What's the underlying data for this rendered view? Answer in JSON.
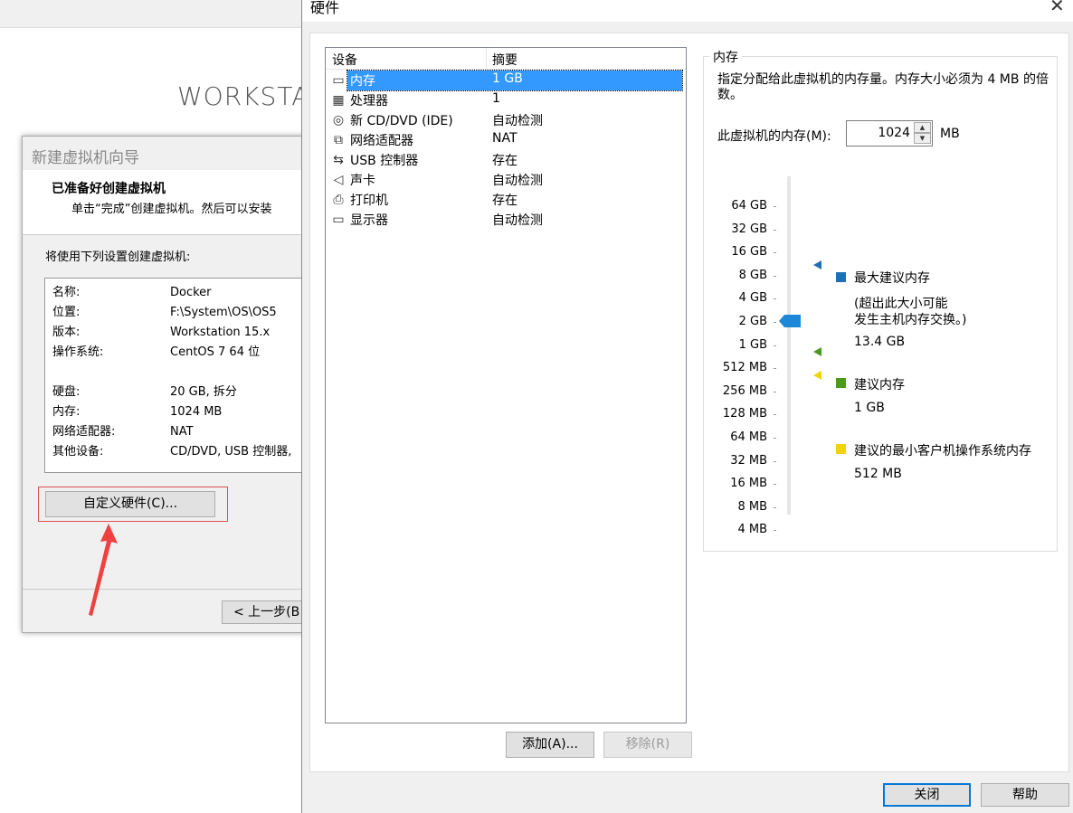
{
  "background": {
    "logo_text": "WORKSTA"
  },
  "wizard": {
    "title": "新建虚拟机向导",
    "heading": "已准备好创建虚拟机",
    "subheading": "单击“完成”创建虚拟机。然后可以安装",
    "intro": "将使用下列设置创建虚拟机:",
    "summary": [
      {
        "key": "名称:",
        "value": "Docker"
      },
      {
        "key": "位置:",
        "value": "F:\\System\\OS\\OS5"
      },
      {
        "key": "版本:",
        "value": "Workstation 15.x"
      },
      {
        "key": "操作系统:",
        "value": "CentOS 7 64 位"
      },
      {
        "key": "硬盘:",
        "value": "20 GB, 拆分"
      },
      {
        "key": "内存:",
        "value": "1024 MB"
      },
      {
        "key": "网络适配器:",
        "value": "NAT"
      },
      {
        "key": "其他设备:",
        "value": "CD/DVD, USB 控制器,"
      }
    ],
    "customize_button": "自定义硬件(C)...",
    "back_button": "< 上一步(B"
  },
  "hardware_dialog": {
    "title": "硬件",
    "close_glyph": "✕",
    "columns": {
      "device": "设备",
      "summary": "摘要"
    },
    "devices": [
      {
        "icon": "memory-icon",
        "glyph": "▭",
        "name": "内存",
        "summary": "1 GB",
        "selected": true
      },
      {
        "icon": "processor-icon",
        "glyph": "▦",
        "name": "处理器",
        "summary": "1",
        "selected": false
      },
      {
        "icon": "cd-dvd-icon",
        "glyph": "◎",
        "name": "新 CD/DVD (IDE)",
        "summary": "自动检测",
        "selected": false
      },
      {
        "icon": "network-adapter-icon",
        "glyph": "⧉",
        "name": "网络适配器",
        "summary": "NAT",
        "selected": false
      },
      {
        "icon": "usb-controller-icon",
        "glyph": "⇆",
        "name": "USB 控制器",
        "summary": "存在",
        "selected": false
      },
      {
        "icon": "sound-card-icon",
        "glyph": "◁",
        "name": "声卡",
        "summary": "自动检测",
        "selected": false
      },
      {
        "icon": "printer-icon",
        "glyph": "⎙",
        "name": "打印机",
        "summary": "存在",
        "selected": false
      },
      {
        "icon": "display-icon",
        "glyph": "▭",
        "name": "显示器",
        "summary": "自动检测",
        "selected": false
      }
    ],
    "add_button": "添加(A)...",
    "remove_button": "移除(R)",
    "close_button": "关闭",
    "help_button": "帮助",
    "memory": {
      "group_label": "内存",
      "description": "指定分配给此虚拟机的内存量。内存大小必须为 4 MB 的倍数。",
      "input_label": "此虚拟机的内存(M):",
      "value": "1024",
      "unit": "MB",
      "scale": [
        "64 GB",
        "32 GB",
        "16 GB",
        "8 GB",
        "4 GB",
        "2 GB",
        "1 GB",
        "512 MB",
        "256 MB",
        "128 MB",
        "64 MB",
        "32 MB",
        "16 MB",
        "8 MB",
        "4 MB"
      ],
      "selected_scale": "1 GB",
      "legend": {
        "max_label": "最大建议内存",
        "max_note_1": "(超出此大小可能",
        "max_note_2": "发生主机内存交换。)",
        "max_value": "13.4 GB",
        "rec_label": "建议内存",
        "rec_value": "1 GB",
        "min_label": "建议的最小客户机操作系统内存",
        "min_value": "512 MB"
      },
      "colors": {
        "max": "#1f6fb5",
        "recommended": "#4a9a1e",
        "minimum": "#f2d30a",
        "thumb": "#1e88d8"
      }
    }
  }
}
